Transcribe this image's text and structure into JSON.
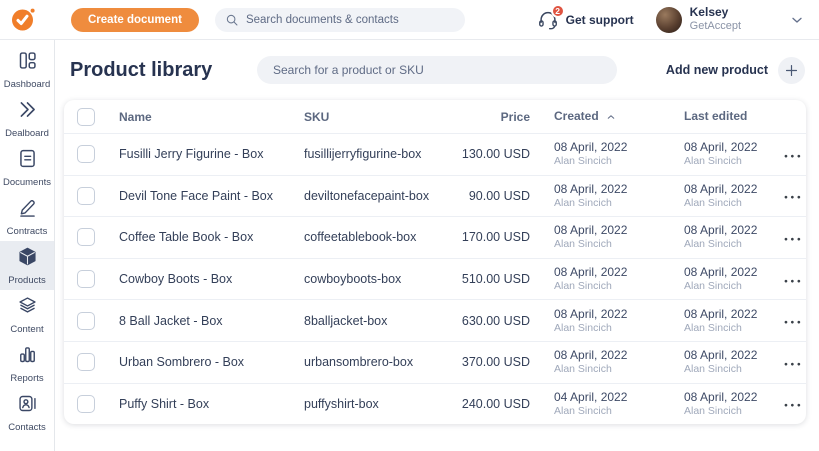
{
  "topbar": {
    "create_button_label": "Create document",
    "search_placeholder": "Search documents & contacts",
    "support": {
      "label": "Get support",
      "badge": "2"
    },
    "user": {
      "name": "Kelsey",
      "org": "GetAccept"
    }
  },
  "sidebar": {
    "items": [
      {
        "label": "Dashboard",
        "icon": "dashboard-icon",
        "active": false
      },
      {
        "label": "Dealboard",
        "icon": "dealboard-icon",
        "active": false
      },
      {
        "label": "Documents",
        "icon": "documents-icon",
        "active": false
      },
      {
        "label": "Contracts",
        "icon": "contracts-icon",
        "active": false
      },
      {
        "label": "Products",
        "icon": "products-icon",
        "active": true
      },
      {
        "label": "Content",
        "icon": "content-icon",
        "active": false
      },
      {
        "label": "Reports",
        "icon": "reports-icon",
        "active": false
      },
      {
        "label": "Contacts",
        "icon": "contacts-icon",
        "active": false
      }
    ]
  },
  "page": {
    "title": "Product library",
    "search_placeholder": "Search for a product or SKU",
    "add_product_label": "Add new product"
  },
  "table": {
    "headers": {
      "name": "Name",
      "sku": "SKU",
      "price": "Price",
      "created": "Created",
      "last_edited": "Last edited"
    },
    "sort": {
      "column": "Created",
      "direction": "ascending"
    },
    "rows": [
      {
        "name": "Fusilli Jerry Figurine - Box",
        "sku": "fusillijerryfigurine-box",
        "price": "130.00 USD",
        "created_date": "08 April, 2022",
        "created_by": "Alan Sincich",
        "edited_date": "08 April, 2022",
        "edited_by": "Alan Sincich"
      },
      {
        "name": "Devil Tone Face Paint - Box",
        "sku": "deviltonefacepaint-box",
        "price": "90.00 USD",
        "created_date": "08 April, 2022",
        "created_by": "Alan Sincich",
        "edited_date": "08 April, 2022",
        "edited_by": "Alan Sincich"
      },
      {
        "name": "Coffee Table Book - Box",
        "sku": "coffeetablebook-box",
        "price": "170.00 USD",
        "created_date": "08 April, 2022",
        "created_by": "Alan Sincich",
        "edited_date": "08 April, 2022",
        "edited_by": "Alan Sincich"
      },
      {
        "name": "Cowboy Boots - Box",
        "sku": "cowboyboots-box",
        "price": "510.00 USD",
        "created_date": "08 April, 2022",
        "created_by": "Alan Sincich",
        "edited_date": "08 April, 2022",
        "edited_by": "Alan Sincich"
      },
      {
        "name": "8 Ball Jacket - Box",
        "sku": "8balljacket-box",
        "price": "630.00 USD",
        "created_date": "08 April, 2022",
        "created_by": "Alan Sincich",
        "edited_date": "08 April, 2022",
        "edited_by": "Alan Sincich"
      },
      {
        "name": "Urban Sombrero - Box",
        "sku": "urbansombrero-box",
        "price": "370.00 USD",
        "created_date": "08 April, 2022",
        "created_by": "Alan Sincich",
        "edited_date": "08 April, 2022",
        "edited_by": "Alan Sincich"
      },
      {
        "name": "Puffy Shirt - Box",
        "sku": "puffyshirt-box",
        "price": "240.00 USD",
        "created_date": "04 April, 2022",
        "created_by": "Alan Sincich",
        "edited_date": "08 April, 2022",
        "edited_by": "Alan Sincich"
      }
    ]
  },
  "colors": {
    "accent_orange": "#EF8C3E",
    "badge_red": "#DF5340",
    "text_dark": "#273350",
    "active_item_bg": "#E9ECF1"
  }
}
